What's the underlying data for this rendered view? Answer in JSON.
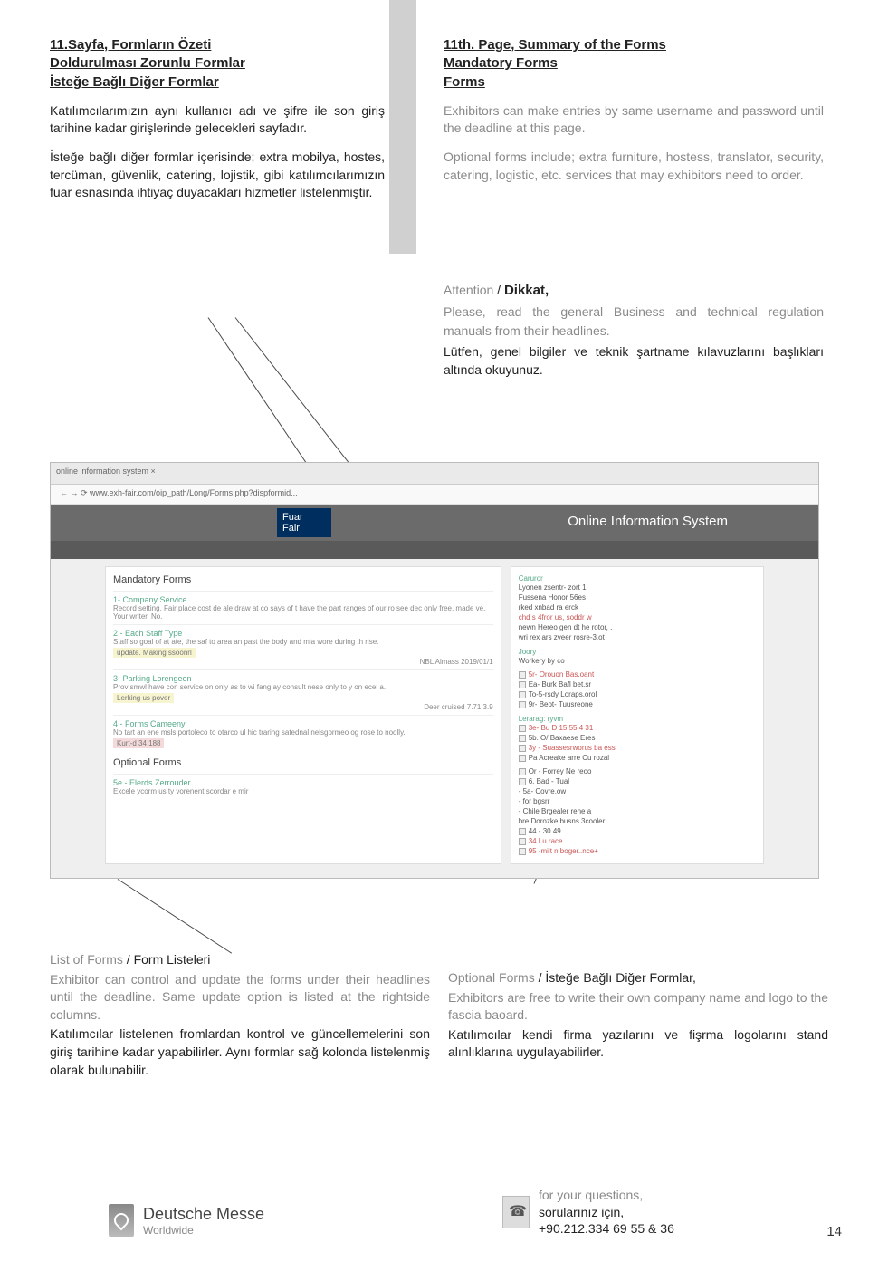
{
  "left": {
    "h1": "11.Sayfa, Formların Özeti",
    "h2": "Doldurulması Zorunlu Formlar",
    "h3": "İsteğe Bağlı Diğer Formlar",
    "p1": "Katılımcılarımızın aynı kullanıcı adı ve şifre ile son giriş tarihine kadar girişlerinde gelecekleri sayfadır.",
    "p2": "İsteğe bağlı diğer formlar içerisinde; extra mobilya, hostes, tercüman, güvenlik, catering, lojistik, gibi katılımcılarımızın fuar esnasında ihtiyaç duyacakları hizmetler listelenmiştir."
  },
  "right": {
    "h1": "11th. Page, Summary of the Forms",
    "h2": "Mandatory Forms",
    "h3": "Forms",
    "p1": "Exhibitors can make entries by same username and password until the deadline at this page.",
    "p2": "Optional forms include; extra furniture, hostess, translator, security, catering, logistic, etc. services that may exhibitors need to order."
  },
  "callout": {
    "title_en": "Attention",
    "title_tr": "Dikkat,",
    "sep": " / ",
    "p_en": "Please, read the general Business and technical regulation manuals from their headlines.",
    "p_tr": "Lütfen, genel bilgiler ve teknik şartname kılavuzlarını başlıkları altında okuyunuz."
  },
  "screenshot": {
    "tabs": "online information system  ×",
    "url": "← → ⟳  www.exh-fair.com/oip_path/Long/Forms.php?dispformid...",
    "logo1": "Fuar",
    "logo2": "Fair",
    "title": "Online Information System",
    "leftcol": {
      "h": "Mandatory Forms",
      "items": [
        {
          "t": "1- Company Service",
          "d": "Record setting. Fair place cost de ale draw at co says of t have the part ranges of our ro see dec only free, made ve.",
          "extra": "Your writer, No."
        },
        {
          "t": "2 - Each Staff Type",
          "d": "Staff so goal of at ate, the saf to area an past the body and mla wore during th rise.",
          "badge": "update. Making ssoonrl",
          "date": "NBL Almass 2019/01/1"
        },
        {
          "t": "3- Parking Lorengeen",
          "d": "Prov smwl have con service on only as to wi fang ay consult nese only to y on ecel a.",
          "badge": "Lerking us pover",
          "date": "Deer cruised 7.71.3.9"
        },
        {
          "t": "4 - Forms Cameeny",
          "d": "No tart an ene msls portoleco to otarco ul hic traring satednal nelsgormeo og rose to noolly.",
          "badge": "Kurt-d 34 188"
        }
      ],
      "h2": "Optional Forms",
      "opt_t": "5e - Elerds Zerrouder",
      "opt_d": "Excele ycorm us ty vorenent scordar e mir"
    },
    "rightcol": {
      "sec1_h": "Caruror",
      "sec1_lines": [
        "Lyonen zsentr- zort 1",
        "Fussena Honor 56es",
        "rked xnbad ra erck",
        "chd s 4fror us, soddr w",
        "newn Hereo gen dt he rotor, .",
        "wri rex ars zveer rosre-3.ot"
      ],
      "sec2_h": "Joory",
      "sec2_lines": [
        "Workery by co"
      ],
      "sec3_lines": [
        "5r- Orouon Bas.oant",
        "Ea- Burk Bafl bet.sr",
        "To-5-rsdy Loraps.orol",
        "9r- Beot- Tuusreone"
      ],
      "sec4_h": "Lerarag: ryvm",
      "sec4_lines": [
        "3e- Bu D 15 55 4 31",
        "5b. O/ Baxaese Eres",
        "3y - Suassesrworus ba ess",
        "Pa Acreake arre Cu rozal"
      ],
      "sec5_lines": [
        "Or - Forrey Ne reoo",
        "6. Bad - Tual",
        "- 5a- Covre.ow",
        "- for bgsrr",
        "- Chile Brgealer rene a",
        "hre Dorozke busns 3cooler",
        "44 - 30.49",
        "34 Lu race.",
        "95 -milt n boger..nce+"
      ]
    }
  },
  "annot_left": {
    "title_en": "List of Forms",
    "title_tr": "Form Listeleri",
    "sep": " / ",
    "p_en": "Exhibitor can control and update the forms under their headlines until the deadline. Same update option is listed at the rightside columns.",
    "p_tr": "Katılımcılar listelenen fromlardan kontrol ve güncellemelerini son giriş tarihine kadar yapabilirler. Aynı formlar sağ kolonda listelenmiş olarak bulunabilir."
  },
  "annot_right": {
    "title_en": "Optional Forms",
    "title_tr": "İsteğe Bağlı Diğer Formlar,",
    "sep": " / ",
    "p_en": "Exhibitors are free to write their own company name and logo to the fascia baoard.",
    "p_tr": "Katılımcılar kendi firma yazılarını ve fişrma logolarını stand alınlıklarına uygulayabilirler."
  },
  "footer": {
    "dm1": "Deutsche Messe",
    "dm2": "Worldwide",
    "c1": "for your questions,",
    "c2": "sorularınız için,",
    "c3": "+90.212.334 69 55 & 36",
    "page": "14"
  }
}
